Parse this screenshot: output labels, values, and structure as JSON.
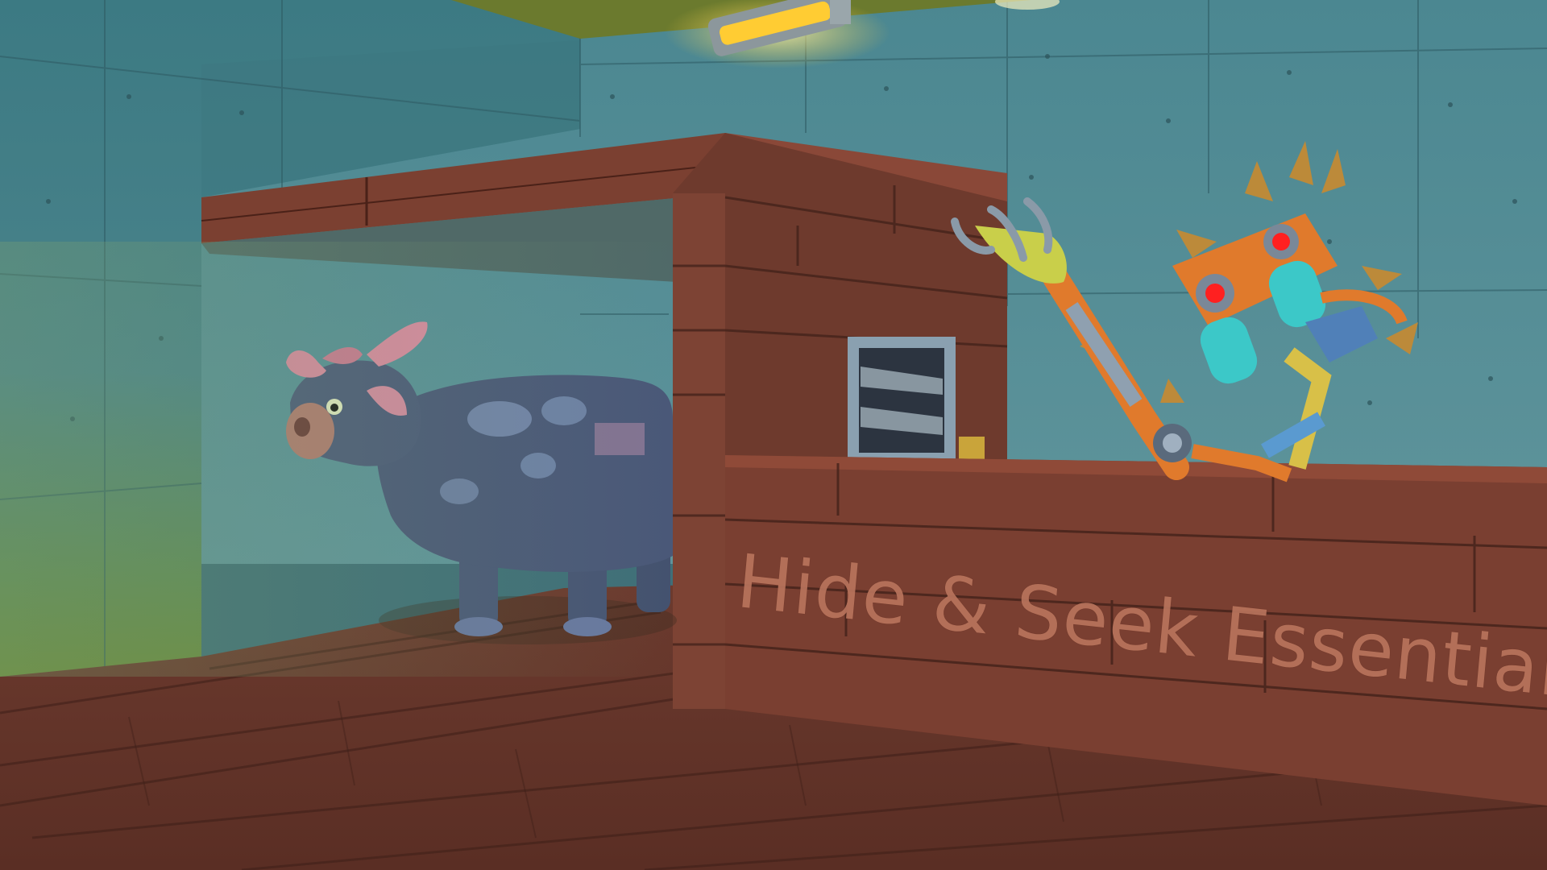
{
  "scene": {
    "sign_text": "Hide & Seek Essentials"
  },
  "colors": {
    "wall": "#4f8790",
    "wall_dark": "#3b6a73",
    "floor": "#6b3a2e",
    "wood": "#7a3f31",
    "wood_light": "#8f4a38",
    "ceiling_light": "#ffcc33",
    "cow_body": "#4a5878",
    "cow_horn": "#d88aa0",
    "robot_orange": "#e07a2c",
    "robot_eye": "#ff2020",
    "robot_cyan": "#3cc8c8",
    "foliage": "#c88a30"
  },
  "icons": [
    "ceiling-lamp-icon",
    "vent-icon"
  ]
}
